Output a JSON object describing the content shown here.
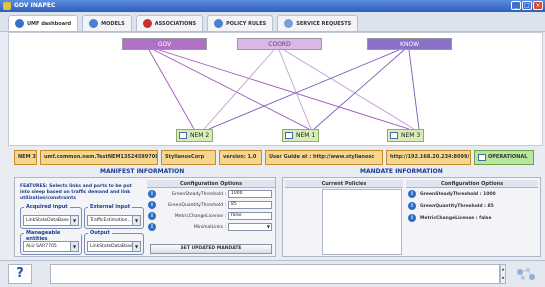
{
  "window": {
    "title": "GOV INAPEC"
  },
  "tabs": [
    {
      "label": "UMF dashboard",
      "color": "#3a6fc8"
    },
    {
      "label": "MODELS",
      "color": "#4a7fd0"
    },
    {
      "label": "ASSOCIATIONS",
      "color": "#c8322a"
    },
    {
      "label": "POLICY RULES",
      "color": "#4a7fd0"
    },
    {
      "label": "SERVICE REQUESTS",
      "color": "#7a9fd8"
    }
  ],
  "topology": {
    "top_nodes": [
      {
        "label": "GOV",
        "color": "#b070c8"
      },
      {
        "label": "COORD",
        "color": "#dcb6e6"
      },
      {
        "label": "KNOW",
        "color": "#8a70c8"
      }
    ],
    "nems": [
      {
        "label": "NEM 2"
      },
      {
        "label": "NEM 1"
      },
      {
        "label": "NEM 3"
      }
    ]
  },
  "infobar": {
    "nem": "NEM 3",
    "uid": "umf.common.nem.TestNEM1352459970890",
    "company": "StylianosCorp",
    "version": "version: 1.0",
    "guide": "User Guide at : http://www.stylianosc",
    "url": "http://192.168.20.234:8099/",
    "status": "OPERATIONAL"
  },
  "manifest": {
    "title": "MANIFEST INFORMATION",
    "features": "FEATURES: Selects links and ports to be put into sleep based on traffic demand and link utilization/constraints",
    "acquired_input": {
      "label": "Acquired input",
      "value": "LinkStateDataBase"
    },
    "external_input": {
      "label": "External input",
      "value": "TrafficEstimation..."
    },
    "manageable_entities": {
      "label": "Manageable entities",
      "value": "ALU SAR7705"
    },
    "output": {
      "label": "Output",
      "value": "LinkStateDataBase"
    },
    "config": {
      "header": "Configuration Options",
      "rows": [
        {
          "label": "GreenSteadyThreshold :",
          "value": "1000"
        },
        {
          "label": "GreenQuantityThreshold :",
          "value": "85"
        },
        {
          "label": "MetricChangeLicense :",
          "value": "false"
        },
        {
          "label": "MinimalLinks :",
          "value": ""
        }
      ],
      "button": "SET UPDATED MANDATE"
    }
  },
  "mandate": {
    "title": "MANDATE INFORMATION",
    "policies_header": "Current Policies",
    "config_header": "Configuration Options",
    "rows": [
      "GreenSteadyThreshold : 1000",
      "GreenQuantityThreshold : 85",
      "MetricChangeLicense : false"
    ]
  },
  "help": {
    "glyph": "?"
  }
}
